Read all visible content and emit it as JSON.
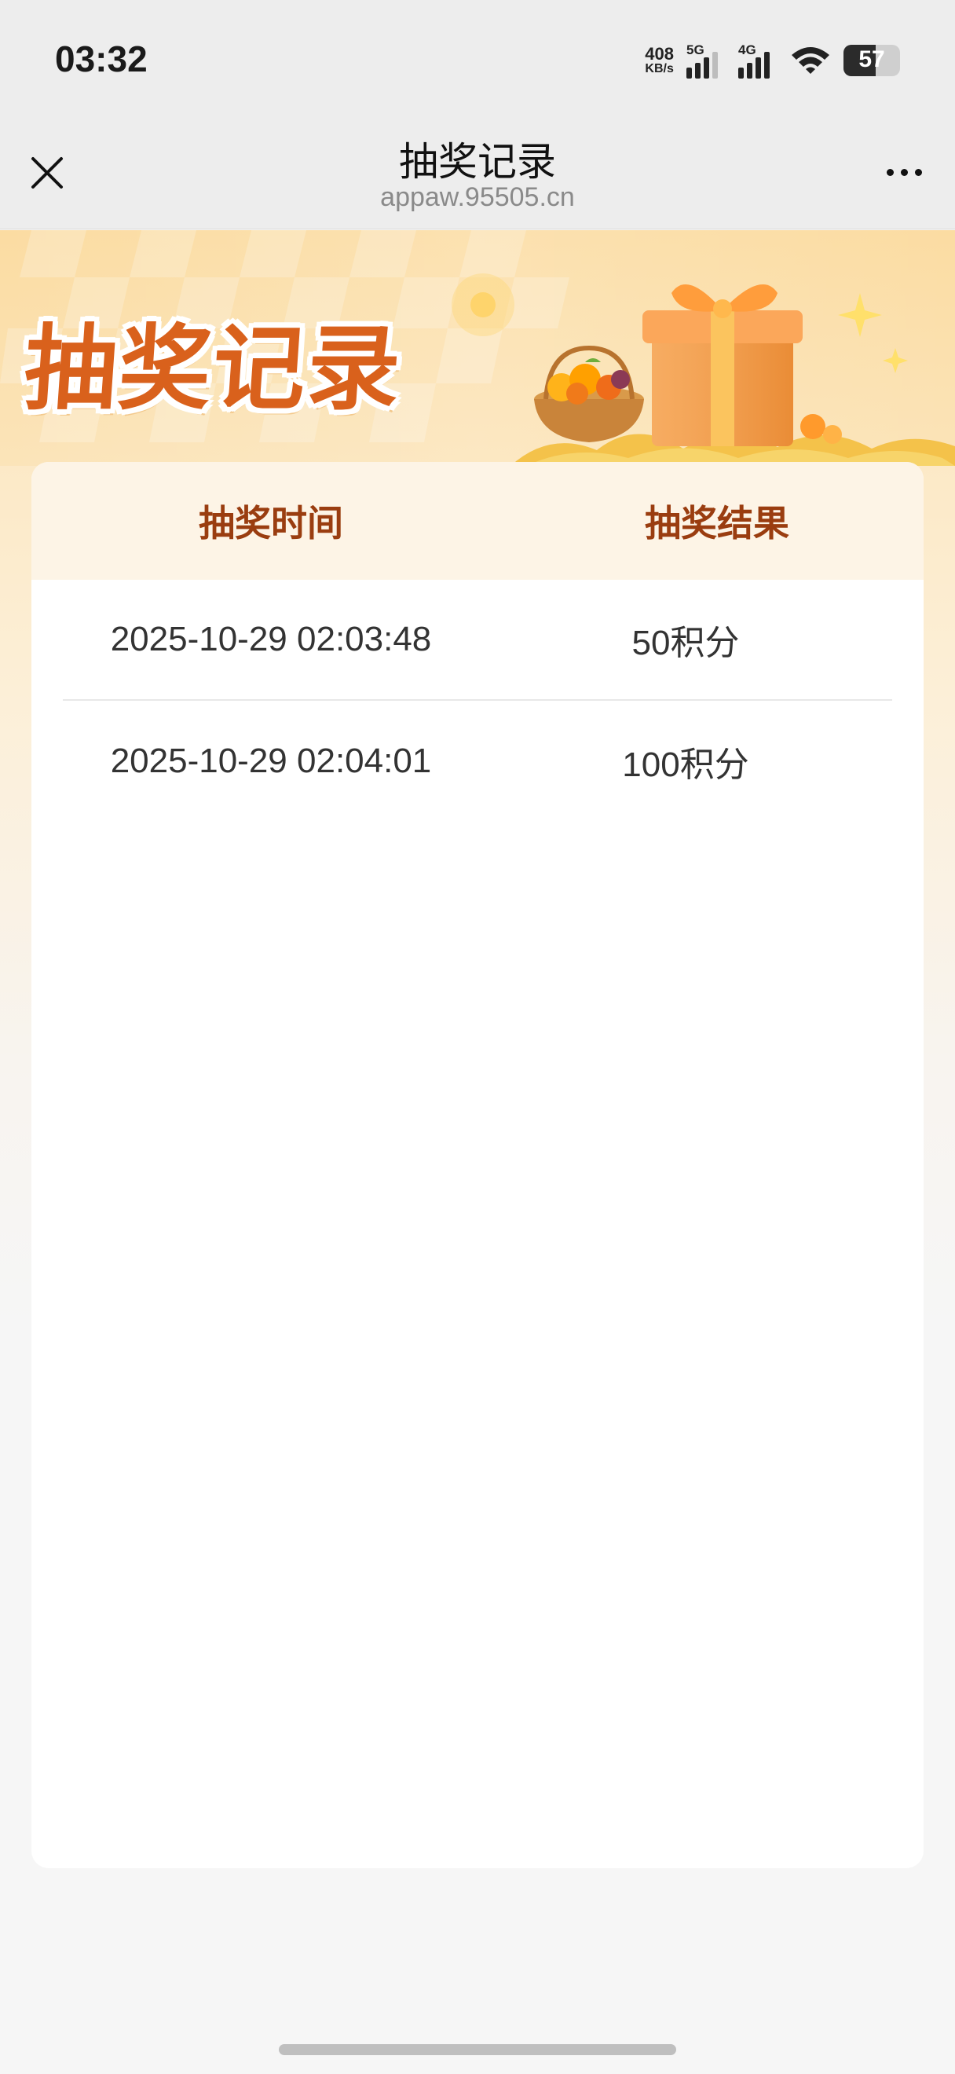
{
  "status_bar": {
    "time": "03:32",
    "net_speed_value": "408",
    "net_speed_unit": "KB/s",
    "signal_1_label": "5G",
    "signal_2_label": "4G",
    "battery": "57"
  },
  "nav": {
    "title": "抽奖记录",
    "url": "appaw.95505.cn",
    "close_icon": "close-icon",
    "more_icon": "more-icon"
  },
  "banner": {
    "title": "抽奖记录"
  },
  "table": {
    "headers": [
      "抽奖时间",
      "抽奖结果"
    ],
    "rows": [
      {
        "time": "2025-10-29 02:03:48",
        "result": "50积分"
      },
      {
        "time": "2025-10-29 02:04:01",
        "result": "100积分"
      }
    ]
  },
  "colors": {
    "accent": "#d9611c",
    "header_text": "#9a3d10",
    "header_bg": "#fdf4e6"
  }
}
